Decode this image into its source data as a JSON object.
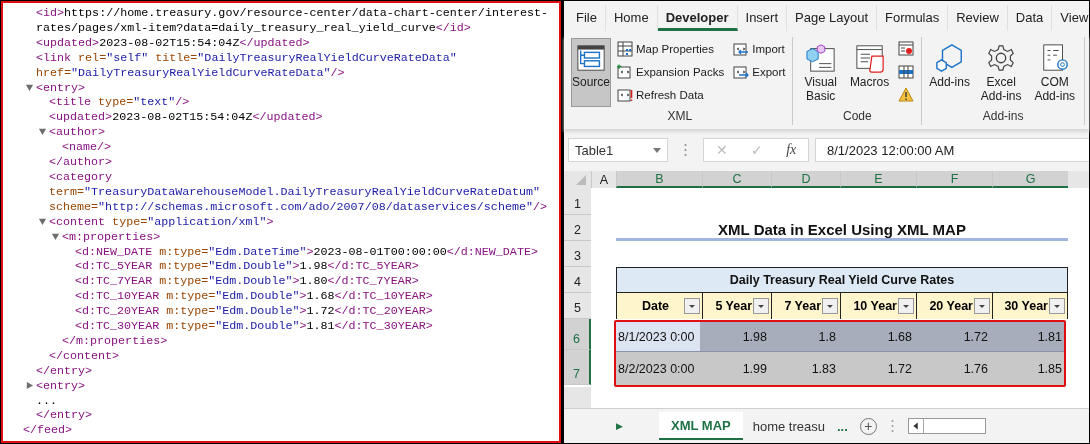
{
  "xml_source": {
    "lines": [
      {
        "parts": [
          {
            "kind": "tag",
            "text": "<id>"
          },
          {
            "kind": "text",
            "text": "https://home.treasury.gov/resource-center/data-chart-center/interest-rates/pages/xml-item?data=daily_treasury_real_yield_curve"
          },
          {
            "kind": "tag",
            "text": "</id>"
          }
        ]
      },
      {
        "parts": [
          {
            "kind": "tag",
            "text": "<updated>"
          },
          {
            "kind": "text",
            "text": "2023-08-02T15:54:04Z"
          },
          {
            "kind": "tag",
            "text": "</updated>"
          }
        ]
      },
      {
        "parts": [
          {
            "kind": "tag",
            "text": "<link"
          },
          {
            "kind": "attr",
            "text": " rel="
          },
          {
            "kind": "value",
            "text": "\"self\""
          },
          {
            "kind": "attr",
            "text": " title="
          },
          {
            "kind": "value",
            "text": "\"DailyTreasuryRealYieldCurveRateData\""
          },
          {
            "kind": "attr",
            "text": " href="
          },
          {
            "kind": "value",
            "text": "\"DailyTreasuryRealYieldCurveRateData\""
          },
          {
            "kind": "tag",
            "text": "/>"
          }
        ]
      },
      {
        "parts": [
          {
            "kind": "tag",
            "text": "<entry>"
          }
        ],
        "expanded": true,
        "children": [
          {
            "parts": [
              {
                "kind": "tag",
                "text": "<title"
              },
              {
                "kind": "attr",
                "text": " type="
              },
              {
                "kind": "value",
                "text": "\"text\""
              },
              {
                "kind": "tag",
                "text": "/>"
              }
            ]
          },
          {
            "parts": [
              {
                "kind": "tag",
                "text": "<updated>"
              },
              {
                "kind": "text",
                "text": "2023-08-02T15:54:04Z"
              },
              {
                "kind": "tag",
                "text": "</updated>"
              }
            ]
          },
          {
            "parts": [
              {
                "kind": "tag",
                "text": "<author>"
              }
            ],
            "expanded": true,
            "children": [
              {
                "parts": [
                  {
                    "kind": "tag",
                    "text": "<name/>"
                  }
                ]
              }
            ]
          },
          {
            "parts": [
              {
                "kind": "tag",
                "text": "</author>"
              }
            ]
          },
          {
            "parts": [
              {
                "kind": "tag",
                "text": "<category"
              },
              {
                "kind": "attr",
                "text": " term="
              },
              {
                "kind": "value",
                "text": "\"TreasuryDataWarehouseModel.DailyTreasuryRealYieldCurveRateDatum\""
              },
              {
                "kind": "attr",
                "text": " scheme="
              },
              {
                "kind": "value",
                "text": "\"http://schemas.microsoft.com/ado/2007/08/dataservices/scheme\""
              },
              {
                "kind": "tag",
                "text": "/>"
              }
            ]
          },
          {
            "parts": [
              {
                "kind": "tag",
                "text": "<content"
              },
              {
                "kind": "attr",
                "text": " type="
              },
              {
                "kind": "value",
                "text": "\"application/xml\""
              },
              {
                "kind": "tag",
                "text": ">"
              }
            ],
            "expanded": true,
            "children": [
              {
                "parts": [
                  {
                    "kind": "tag",
                    "text": "<m:properties>"
                  }
                ],
                "expanded": true,
                "children": [
                  {
                    "parts": [
                      {
                        "kind": "tag",
                        "text": "<d:NEW_DATE"
                      },
                      {
                        "kind": "attr",
                        "text": " m:type="
                      },
                      {
                        "kind": "value",
                        "text": "\"Edm.DateTime\""
                      },
                      {
                        "kind": "tag",
                        "text": ">"
                      },
                      {
                        "kind": "text",
                        "text": "2023-08-01T00:00:00"
                      },
                      {
                        "kind": "tag",
                        "text": "</d:NEW_DATE>"
                      }
                    ]
                  },
                  {
                    "parts": [
                      {
                        "kind": "tag",
                        "text": "<d:TC_5YEAR"
                      },
                      {
                        "kind": "attr",
                        "text": " m:type="
                      },
                      {
                        "kind": "value",
                        "text": "\"Edm.Double\""
                      },
                      {
                        "kind": "tag",
                        "text": ">"
                      },
                      {
                        "kind": "text",
                        "text": "1.98"
                      },
                      {
                        "kind": "tag",
                        "text": "</d:TC_5YEAR>"
                      }
                    ]
                  },
                  {
                    "parts": [
                      {
                        "kind": "tag",
                        "text": "<d:TC_7YEAR"
                      },
                      {
                        "kind": "attr",
                        "text": " m:type="
                      },
                      {
                        "kind": "value",
                        "text": "\"Edm.Double\""
                      },
                      {
                        "kind": "tag",
                        "text": ">"
                      },
                      {
                        "kind": "text",
                        "text": "1.80"
                      },
                      {
                        "kind": "tag",
                        "text": "</d:TC_7YEAR>"
                      }
                    ]
                  },
                  {
                    "parts": [
                      {
                        "kind": "tag",
                        "text": "<d:TC_10YEAR"
                      },
                      {
                        "kind": "attr",
                        "text": " m:type="
                      },
                      {
                        "kind": "value",
                        "text": "\"Edm.Double\""
                      },
                      {
                        "kind": "tag",
                        "text": ">"
                      },
                      {
                        "kind": "text",
                        "text": "1.68"
                      },
                      {
                        "kind": "tag",
                        "text": "</d:TC_10YEAR>"
                      }
                    ]
                  },
                  {
                    "parts": [
                      {
                        "kind": "tag",
                        "text": "<d:TC_20YEAR"
                      },
                      {
                        "kind": "attr",
                        "text": " m:type="
                      },
                      {
                        "kind": "value",
                        "text": "\"Edm.Double\""
                      },
                      {
                        "kind": "tag",
                        "text": ">"
                      },
                      {
                        "kind": "text",
                        "text": "1.72"
                      },
                      {
                        "kind": "tag",
                        "text": "</d:TC_20YEAR>"
                      }
                    ]
                  },
                  {
                    "parts": [
                      {
                        "kind": "tag",
                        "text": "<d:TC_30YEAR"
                      },
                      {
                        "kind": "attr",
                        "text": " m:type="
                      },
                      {
                        "kind": "value",
                        "text": "\"Edm.Double\""
                      },
                      {
                        "kind": "tag",
                        "text": ">"
                      },
                      {
                        "kind": "text",
                        "text": "1.81"
                      },
                      {
                        "kind": "tag",
                        "text": "</d:TC_30YEAR>"
                      }
                    ]
                  }
                ]
              },
              {
                "parts": [
                  {
                    "kind": "tag",
                    "text": "</m:properties>"
                  }
                ]
              }
            ]
          },
          {
            "parts": [
              {
                "kind": "tag",
                "text": "</content>"
              }
            ]
          }
        ]
      },
      {
        "parts": [
          {
            "kind": "tag",
            "text": "</entry>"
          }
        ]
      },
      {
        "parts": [
          {
            "kind": "tag",
            "text": "<entry>"
          }
        ],
        "expanded": false
      },
      {
        "parts": [
          {
            "kind": "text",
            "text": "..."
          }
        ]
      },
      {
        "parts": [
          {
            "kind": "tag",
            "text": "</entry>"
          }
        ]
      }
    ],
    "end_line": {
      "parts": [
        {
          "kind": "tag",
          "text": "</feed>"
        }
      ]
    }
  },
  "ribbon": {
    "tabs": [
      {
        "label": "File",
        "selected": false
      },
      {
        "label": "Home",
        "selected": false
      },
      {
        "label": "Developer",
        "selected": true
      },
      {
        "label": "Insert",
        "selected": false
      },
      {
        "label": "Page Layout",
        "selected": false
      },
      {
        "label": "Formulas",
        "selected": false
      },
      {
        "label": "Review",
        "selected": false
      },
      {
        "label": "Data",
        "selected": false
      },
      {
        "label": "View",
        "selected": false
      }
    ],
    "groups": [
      {
        "label": "XML",
        "buttons": [
          {
            "kind": "large",
            "label": "Source",
            "pressed": true
          },
          {
            "kind": "small",
            "label": "Map Properties",
            "pressed": false
          },
          {
            "kind": "small",
            "label": "Expansion Packs",
            "pressed": false
          },
          {
            "kind": "small",
            "label": "Refresh Data",
            "pressed": false
          },
          {
            "kind": "small",
            "label": "Import",
            "pressed": false
          },
          {
            "kind": "small",
            "label": "Export",
            "pressed": false
          }
        ]
      },
      {
        "label": "Code",
        "buttons": [
          {
            "kind": "large",
            "label": "Visual Basic",
            "pressed": false
          },
          {
            "kind": "large",
            "label": "Macros",
            "pressed": false
          },
          {
            "kind": "icon",
            "pressed": false
          },
          {
            "kind": "icon",
            "pressed": false
          },
          {
            "kind": "icon",
            "pressed": false
          }
        ]
      },
      {
        "label": "Add-ins",
        "buttons": [
          {
            "kind": "large",
            "label": "Add-ins",
            "pressed": false
          },
          {
            "kind": "large",
            "label": "Excel Add-ins",
            "pressed": false
          },
          {
            "kind": "large",
            "label": "COM Add-ins",
            "pressed": false
          }
        ]
      }
    ]
  },
  "formula_bar": {
    "name_box": "Table1",
    "cancel": "✕",
    "enter": "✓",
    "function": "fx",
    "value": "8/1/2023  12:00:00 AM"
  },
  "sheet": {
    "columns": [
      {
        "label": "A",
        "selected": false
      },
      {
        "label": "B",
        "selected": true
      },
      {
        "label": "C",
        "selected": true
      },
      {
        "label": "D",
        "selected": true
      },
      {
        "label": "E",
        "selected": true
      },
      {
        "label": "F",
        "selected": true
      },
      {
        "label": "G",
        "selected": true
      }
    ],
    "row_numbers": [
      {
        "label": "1",
        "selected": false
      },
      {
        "label": "2",
        "selected": false
      },
      {
        "label": "3",
        "selected": false
      },
      {
        "label": "4",
        "selected": false
      },
      {
        "label": "5",
        "selected": false
      },
      {
        "label": "6",
        "selected": true
      },
      {
        "label": "7",
        "selected": true
      }
    ],
    "title": "XML Data in Excel Using XML MAP",
    "table": {
      "title": "Daily Treasury Real Yield Curve Rates",
      "headers": [
        "Date",
        "5 Year",
        "7 Year",
        "10 Year",
        "20 Year",
        "30 Year"
      ],
      "rows": [
        {
          "active": true,
          "cells": [
            "8/1/2023 0:00",
            "1.98",
            "1.8",
            "1.68",
            "1.72",
            "1.81"
          ]
        },
        {
          "active": false,
          "cells": [
            "8/2/2023 0:00",
            "1.99",
            "1.83",
            "1.72",
            "1.76",
            "1.85"
          ]
        }
      ]
    }
  },
  "sheet_tabs": {
    "next": "▶",
    "tabs": [
      {
        "label": "XML MAP",
        "selected": true
      },
      {
        "label": "home treasu",
        "selected": false
      }
    ],
    "more": "...",
    "add": "+"
  }
}
